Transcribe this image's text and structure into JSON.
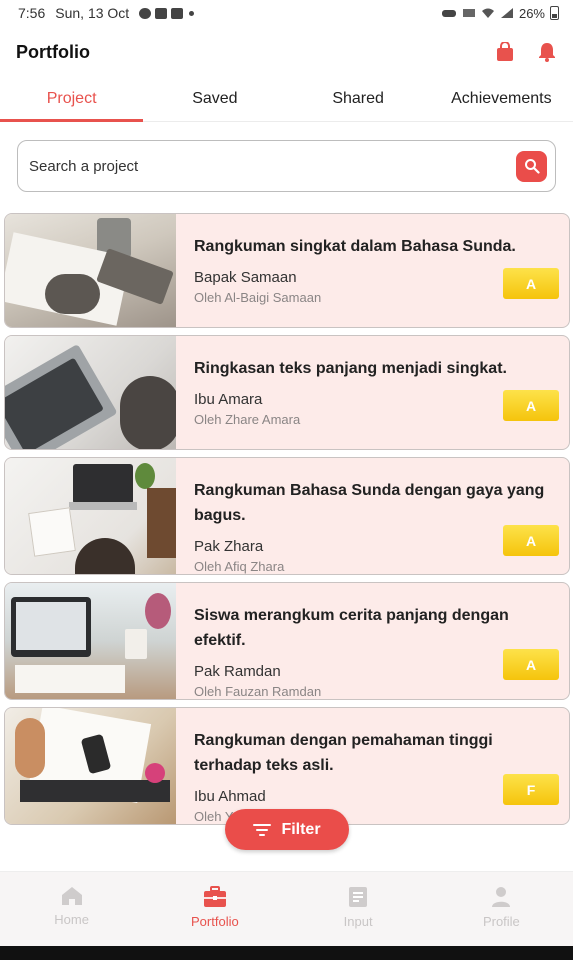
{
  "status_bar": {
    "time": "7:56",
    "date": "Sun, 13 Oct",
    "battery": "26%"
  },
  "app_bar": {
    "title": "Portfolio",
    "icons": [
      "shopping-bag-icon",
      "bell-icon"
    ]
  },
  "tabs": [
    {
      "label": "Project",
      "active": true
    },
    {
      "label": "Saved",
      "active": false
    },
    {
      "label": "Shared",
      "active": false
    },
    {
      "label": "Achievements",
      "active": false
    }
  ],
  "search": {
    "placeholder": "Search a project"
  },
  "projects": [
    {
      "title": "Rangkuman singkat dalam Bahasa Sunda.",
      "author": "Bapak Samaan",
      "by": "Oleh Al-Baigi Samaan",
      "grade": "A"
    },
    {
      "title": "Ringkasan teks panjang menjadi singkat.",
      "author": "Ibu Amara",
      "by": "Oleh Zhare Amara",
      "grade": "A"
    },
    {
      "title": "Rangkuman Bahasa Sunda dengan gaya yang bagus.",
      "author": "Pak Zhara",
      "by": "Oleh Afiq Zhara",
      "grade": "A"
    },
    {
      "title": "Siswa merangkum cerita panjang dengan efektif.",
      "author": "Pak Ramdan",
      "by": "Oleh Fauzan Ramdan",
      "grade": "A"
    },
    {
      "title": "Rangkuman dengan pemahaman tinggi terhadap teks asli.",
      "author": "Ibu Ahmad",
      "by": "Oleh Yusuf Ahmad",
      "grade": "F"
    }
  ],
  "filter_button": {
    "label": "Filter"
  },
  "bottom_nav": [
    {
      "label": "Home",
      "icon": "home-icon",
      "active": false
    },
    {
      "label": "Portfolio",
      "icon": "briefcase-icon",
      "active": true
    },
    {
      "label": "Input",
      "icon": "document-icon",
      "active": false
    },
    {
      "label": "Profile",
      "icon": "person-icon",
      "active": false
    }
  ],
  "colors": {
    "accent": "#ea4d4a",
    "card_bg": "#fdebe9",
    "grade_yellow": "#f7c923"
  }
}
